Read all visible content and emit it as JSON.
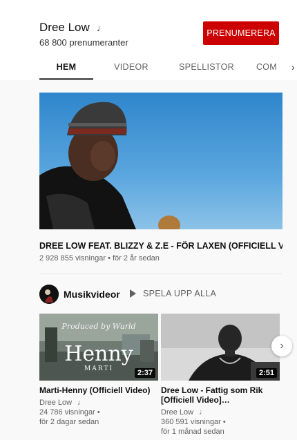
{
  "channel": {
    "name": "Dree Low",
    "note_icon": "music-note-icon",
    "subscribers": "68 800 prenumeranter",
    "subscribe_label": "PRENUMERERA",
    "accent_color": "#cc0000"
  },
  "tabs": [
    {
      "label": "HEM",
      "active": true
    },
    {
      "label": "VIDEOR",
      "active": false
    },
    {
      "label": "SPELLISTOR",
      "active": false
    },
    {
      "label": "COM",
      "active": false
    }
  ],
  "tabs_scroll_icon": "chevron-right-icon",
  "featured": {
    "title": "DREE LOW FEAT. BLIZZY & Z.E - FÖR LAXEN (OFFICIELL VIDE…",
    "meta": "2 928 855 visningar • för 2 år sedan"
  },
  "shelf": {
    "title": "Musikvideor",
    "play_all_label": "SPELA UPP ALLA",
    "play_icon": "play-icon",
    "next_icon": "chevron-right-icon",
    "videos": [
      {
        "title": "Marti-Henny (Officiell Video)",
        "channel": "Dree Low",
        "views": "24 786 visningar •",
        "age": "för 2 dagar sedan",
        "duration": "2:37",
        "thumb_text": "Henny",
        "thumb_subtext": "MARTI",
        "thumb_script": "Produced by Wurld"
      },
      {
        "title": "Dree Low - Fattig som Rik [Officiell Video]…",
        "channel": "Dree Low",
        "views": "360 591 visningar •",
        "age": "för 1 månad sedan",
        "duration": "2:51"
      }
    ]
  }
}
